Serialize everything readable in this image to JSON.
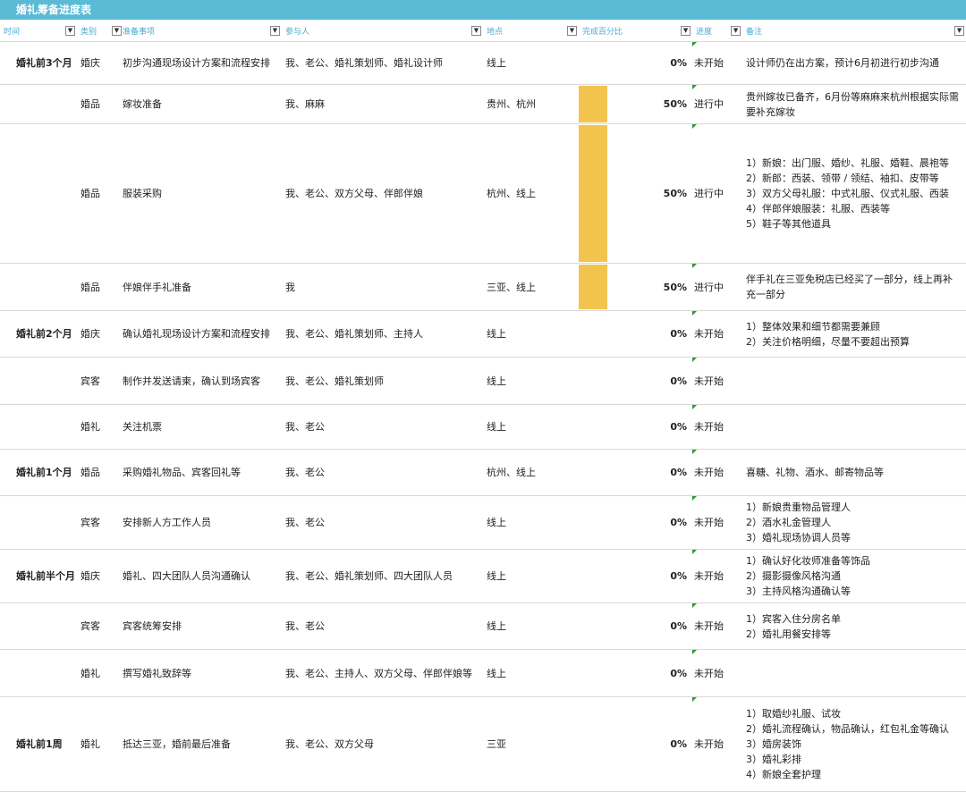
{
  "sheet_title": "婚礼筹备进度表",
  "headers": {
    "time": "时间",
    "category": "类别",
    "task": "准备事项",
    "participants": "参与人",
    "location": "地点",
    "percent_bar": "完成百分比",
    "progress": "进度",
    "notes": "备注"
  },
  "rows": [
    {
      "time": "婚礼前3个月",
      "category": "婚庆",
      "task": "初步沟通现场设计方案和流程安排",
      "participants": "我、老公、婚礼策划师、婚礼设计师",
      "location": "线上",
      "completion": 0,
      "percent": "0%",
      "status": "未开始",
      "notes": [
        "设计师仍在出方案，预计6月初进行初步沟通"
      ]
    },
    {
      "time": "",
      "category": "婚品",
      "task": "嫁妆准备",
      "participants": "我、麻麻",
      "location": "贵州、杭州",
      "completion": 0.5,
      "percent": "50%",
      "status": "进行中",
      "notes": [
        "贵州嫁妆已备齐，6月份等麻麻来杭州根据实际需要补充嫁妆"
      ]
    },
    {
      "time": "",
      "category": "婚品",
      "task": "服装采购",
      "participants": "我、老公、双方父母、伴郎伴娘",
      "location": "杭州、线上",
      "completion": 0.5,
      "percent": "50%",
      "status": "进行中",
      "notes": [
        "1）新娘：出门服、婚纱、礼服、婚鞋、晨袍等",
        "2）新郎：西装、领带 / 领结、袖扣、皮带等",
        "3）双方父母礼服：中式礼服、仪式礼服、西装",
        "4）伴郎伴娘服装：礼服、西装等",
        "5）鞋子等其他道具"
      ]
    },
    {
      "time": "",
      "category": "婚品",
      "task": "伴娘伴手礼准备",
      "participants": "我",
      "location": "三亚、线上",
      "completion": 0.5,
      "percent": "50%",
      "status": "进行中",
      "notes": [
        "伴手礼在三亚免税店已经买了一部分，线上再补充一部分"
      ]
    },
    {
      "time": "婚礼前2个月",
      "category": "婚庆",
      "task": "确认婚礼现场设计方案和流程安排",
      "participants": "我、老公、婚礼策划师、主持人",
      "location": "线上",
      "completion": 0,
      "percent": "0%",
      "status": "未开始",
      "notes": [
        "1）整体效果和细节都需要兼顾",
        "2）关注价格明细，尽量不要超出预算"
      ]
    },
    {
      "time": "",
      "category": "宾客",
      "task": "制作并发送请柬，确认到场宾客",
      "participants": "我、老公、婚礼策划师",
      "location": "线上",
      "completion": 0,
      "percent": "0%",
      "status": "未开始",
      "notes": []
    },
    {
      "time": "",
      "category": "婚礼",
      "task": "关注机票",
      "participants": "我、老公",
      "location": "线上",
      "completion": 0,
      "percent": "0%",
      "status": "未开始",
      "notes": []
    },
    {
      "time": "婚礼前1个月",
      "category": "婚品",
      "task": "采购婚礼物品、宾客回礼等",
      "participants": "我、老公",
      "location": "杭州、线上",
      "completion": 0,
      "percent": "0%",
      "status": "未开始",
      "notes": [
        "喜糖、礼物、酒水、邮寄物品等"
      ]
    },
    {
      "time": "",
      "category": "宾客",
      "task": "安排新人方工作人员",
      "participants": "我、老公",
      "location": "线上",
      "completion": 0,
      "percent": "0%",
      "status": "未开始",
      "notes": [
        "1）新娘贵重物品管理人",
        "2）酒水礼金管理人",
        "3）婚礼现场协调人员等"
      ]
    },
    {
      "time": "婚礼前半个月",
      "category": "婚庆",
      "task": "婚礼、四大团队人员沟通确认",
      "participants": "我、老公、婚礼策划师、四大团队人员",
      "location": "线上",
      "completion": 0,
      "percent": "0%",
      "status": "未开始",
      "notes": [
        "1）确认好化妆师准备等饰品",
        "2）摄影摄像风格沟通",
        "3）主持风格沟通确认等"
      ]
    },
    {
      "time": "",
      "category": "宾客",
      "task": "宾客统筹安排",
      "participants": "我、老公",
      "location": "线上",
      "completion": 0,
      "percent": "0%",
      "status": "未开始",
      "notes": [
        "1）宾客入住分房名单",
        "2）婚礼用餐安排等"
      ]
    },
    {
      "time": "",
      "category": "婚礼",
      "task": "撰写婚礼致辞等",
      "participants": "我、老公、主持人、双方父母、伴郎伴娘等",
      "location": "线上",
      "completion": 0,
      "percent": "0%",
      "status": "未开始",
      "notes": []
    },
    {
      "time": "婚礼前1周",
      "category": "婚礼",
      "task": "抵达三亚，婚前最后准备",
      "participants": "我、老公、双方父母",
      "location": "三亚",
      "completion": 0,
      "percent": "0%",
      "status": "未开始",
      "notes": [
        "1）取婚纱礼服、试妆",
        "2）婚礼流程确认，物品确认，红包礼金等确认",
        "3）婚房装饰",
        "3）婚礼彩排",
        "4）新娘全套护理"
      ]
    }
  ],
  "colors": {
    "header_bar": "#5bbad5",
    "header_text": "#4aa9cf",
    "progress_fill": "#f2c44e",
    "comment_marker": "#2e9a2e"
  },
  "icons": {
    "filter": "dropdown-filter-icon"
  }
}
